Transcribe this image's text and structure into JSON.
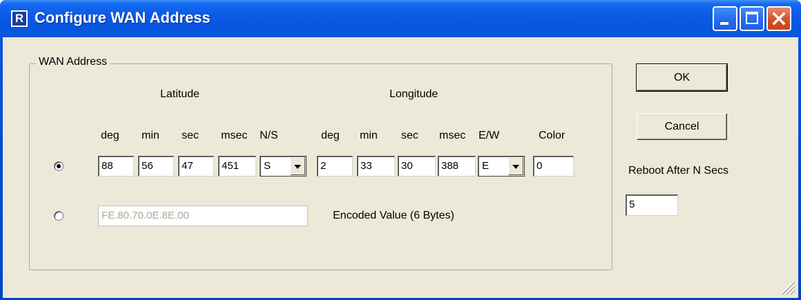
{
  "window": {
    "title": "Configure WAN Address",
    "icon_letter": "R"
  },
  "group": {
    "label": "WAN Address"
  },
  "latitude": {
    "heading": "Latitude",
    "col_labels": [
      "deg",
      "min",
      "sec",
      "msec",
      "N/S"
    ],
    "deg": "88",
    "min": "56",
    "sec": "47",
    "msec": "451",
    "hemisphere": "S"
  },
  "longitude": {
    "heading": "Longitude",
    "col_labels": [
      "deg",
      "min",
      "sec",
      "msec",
      "E/W"
    ],
    "deg": "2",
    "min": "33",
    "sec": "30",
    "msec": "388",
    "hemisphere": "E"
  },
  "color": {
    "label": "Color",
    "value": "0"
  },
  "encoded": {
    "value": "FE.80.70.0E.8E.00",
    "label": "Encoded Value (6 Bytes)"
  },
  "mode": {
    "selected": "coordinates"
  },
  "buttons": {
    "ok": "OK",
    "cancel": "Cancel"
  },
  "reboot": {
    "label": "Reboot After N Secs",
    "value": "5"
  },
  "colors": {
    "titlebar": "#0a5be6",
    "face": "#ece9d8",
    "close": "#d8542e"
  }
}
